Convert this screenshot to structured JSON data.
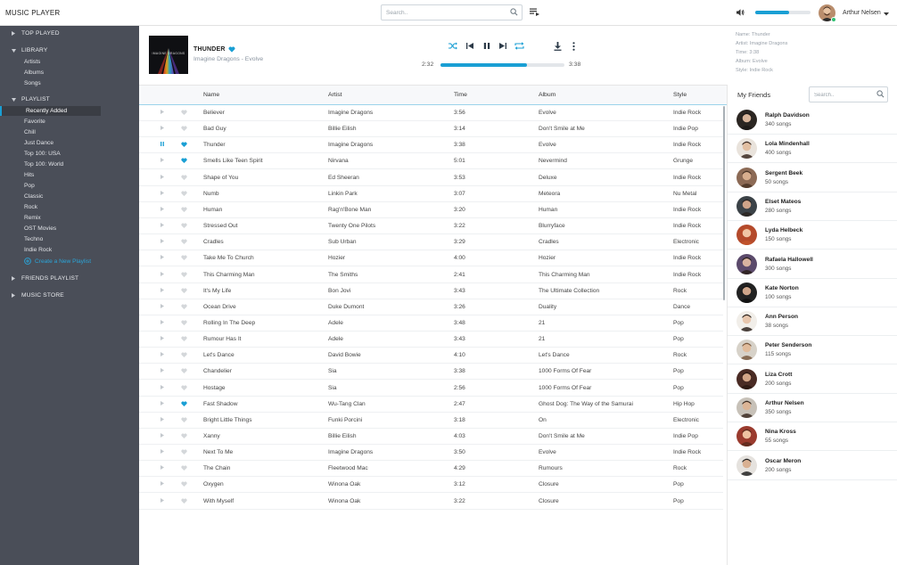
{
  "app": {
    "title": "MUSIC PLAYER"
  },
  "topbar": {
    "search_placeholder": "Search..",
    "volume_level": 0.62,
    "user_name": "Arthur Nelsen"
  },
  "sidebar": {
    "sections": [
      {
        "label": "TOP PLAYED",
        "expanded": false
      },
      {
        "label": "LIBRARY",
        "expanded": true
      },
      {
        "label": "PLAYLIST",
        "expanded": true
      },
      {
        "label": "FRIENDS PLAYLIST",
        "expanded": false
      },
      {
        "label": "MUSIC STORE",
        "expanded": false
      }
    ],
    "library_items": [
      "Artists",
      "Albums",
      "Songs"
    ],
    "playlist_items": [
      "Recently Added",
      "Favorite",
      "Chill",
      "Just Dance",
      "Top 100: USA",
      "Top 100: World",
      "Hits",
      "Pop",
      "Classic",
      "Rock",
      "Remix",
      "OST Movies",
      "Techno",
      "Indie Rock"
    ],
    "active_playlist": "Recently Added",
    "create_label": "Create a New Playlist"
  },
  "player": {
    "cover_text": "IMAGINE DRAGONS",
    "title": "THUNDER",
    "subtitle": "Imagine Dragons - Evolve",
    "elapsed": "2:32",
    "total": "3:38",
    "progress": 0.7
  },
  "track_info": {
    "name": "Name: Thunder",
    "artist": "Artist: Imagine Dragons",
    "time": "Time: 3:38",
    "album": "Album: Evolve",
    "style": "Style: Indie Rock"
  },
  "table": {
    "headers": {
      "name": "Name",
      "artist": "Artist",
      "time": "Time",
      "album": "Album",
      "style": "Style"
    },
    "rows": [
      {
        "name": "Believer",
        "artist": "Imagine Dragons",
        "time": "3:56",
        "album": "Evolve",
        "style": "Indie Rock",
        "liked": false,
        "playing": false
      },
      {
        "name": "Bad Guy",
        "artist": "Billie Eilish",
        "time": "3:14",
        "album": "Don't Smile at Me",
        "style": "Indie Pop",
        "liked": false,
        "playing": false
      },
      {
        "name": "Thunder",
        "artist": "Imagine Dragons",
        "time": "3:38",
        "album": "Evolve",
        "style": "Indie Rock",
        "liked": true,
        "playing": true
      },
      {
        "name": "Smells Like Teen Spirit",
        "artist": "Nirvana",
        "time": "5:01",
        "album": "Nevermind",
        "style": "Grunge",
        "liked": true,
        "playing": false
      },
      {
        "name": "Shape of You",
        "artist": "Ed Sheeran",
        "time": "3:53",
        "album": "Deluxe",
        "style": "Indie Rock",
        "liked": false,
        "playing": false
      },
      {
        "name": "Numb",
        "artist": "Linkin Park",
        "time": "3:07",
        "album": "Meteora",
        "style": "Nu Metal",
        "liked": false,
        "playing": false
      },
      {
        "name": "Human",
        "artist": "Rag'n'Bone Man",
        "time": "3:20",
        "album": "Human",
        "style": "Indie Rock",
        "liked": false,
        "playing": false
      },
      {
        "name": "Stressed Out",
        "artist": "Twenty One Pilots",
        "time": "3:22",
        "album": "Blurryface",
        "style": "Indie Rock",
        "liked": false,
        "playing": false
      },
      {
        "name": "Cradles",
        "artist": "Sub Urban",
        "time": "3:29",
        "album": "Cradles",
        "style": "Electronic",
        "liked": false,
        "playing": false
      },
      {
        "name": "Take Me To Church",
        "artist": "Hozier",
        "time": "4:00",
        "album": "Hozier",
        "style": "Indie Rock",
        "liked": false,
        "playing": false
      },
      {
        "name": "This Charming Man",
        "artist": "The Smiths",
        "time": "2:41",
        "album": "This Charming Man",
        "style": "Indie Rock",
        "liked": false,
        "playing": false
      },
      {
        "name": "It's My Life",
        "artist": "Bon Jovi",
        "time": "3:43",
        "album": "The Ultimate Collection",
        "style": "Rock",
        "liked": false,
        "playing": false
      },
      {
        "name": "Ocean Drive",
        "artist": "Duke Dumont",
        "time": "3:26",
        "album": "Duality",
        "style": "Dance",
        "liked": false,
        "playing": false
      },
      {
        "name": "Rolling In The Deep",
        "artist": "Adele",
        "time": "3:48",
        "album": "21",
        "style": "Pop",
        "liked": false,
        "playing": false
      },
      {
        "name": "Rumour Has It",
        "artist": "Adele",
        "time": "3:43",
        "album": "21",
        "style": "Pop",
        "liked": false,
        "playing": false
      },
      {
        "name": "Let's Dance",
        "artist": "David Bowie",
        "time": "4:10",
        "album": "Let's Dance",
        "style": "Rock",
        "liked": false,
        "playing": false
      },
      {
        "name": "Chandelier",
        "artist": "Sia",
        "time": "3:38",
        "album": "1000 Forms Of Fear",
        "style": "Pop",
        "liked": false,
        "playing": false
      },
      {
        "name": "Hostage",
        "artist": "Sia",
        "time": "2:56",
        "album": "1000 Forms Of Fear",
        "style": "Pop",
        "liked": false,
        "playing": false
      },
      {
        "name": "Fast Shadow",
        "artist": "Wu-Tang Clan",
        "time": "2:47",
        "album": "Ghost Dog: The Way of the Samurai",
        "style": "Hip Hop",
        "liked": true,
        "playing": false
      },
      {
        "name": "Bright Little Things",
        "artist": "Funki Porcini",
        "time": "3:18",
        "album": "On",
        "style": "Electronic",
        "liked": false,
        "playing": false
      },
      {
        "name": "Xanny",
        "artist": "Billie Eilish",
        "time": "4:03",
        "album": "Don't Smile at Me",
        "style": "Indie Pop",
        "liked": false,
        "playing": false
      },
      {
        "name": "Next To Me",
        "artist": "Imagine Dragons",
        "time": "3:50",
        "album": "Evolve",
        "style": "Indie Rock",
        "liked": false,
        "playing": false
      },
      {
        "name": "The Chain",
        "artist": "Fleetwood Mac",
        "time": "4:29",
        "album": "Rumours",
        "style": "Rock",
        "liked": false,
        "playing": false
      },
      {
        "name": "Oxygen",
        "artist": "Winona Oak",
        "time": "3:12",
        "album": "Closure",
        "style": "Pop",
        "liked": false,
        "playing": false
      },
      {
        "name": "With Myself",
        "artist": "Winona Oak",
        "time": "3:22",
        "album": "Closure",
        "style": "Pop",
        "liked": false,
        "playing": false
      }
    ]
  },
  "friends": {
    "title": "My Friends",
    "search_placeholder": "Search..",
    "list": [
      {
        "name": "Ralph Davidson",
        "songs": "340 songs"
      },
      {
        "name": "Lola Mindenhall",
        "songs": "400 songs"
      },
      {
        "name": "Sergent Beek",
        "songs": "50 songs"
      },
      {
        "name": "Elset Mateos",
        "songs": "280 songs"
      },
      {
        "name": "Lyda Helbeck",
        "songs": "150 songs"
      },
      {
        "name": "Rafaela Hallowell",
        "songs": "300 songs"
      },
      {
        "name": "Kate Norton",
        "songs": "100 songs"
      },
      {
        "name": "Ann Person",
        "songs": "38 songs"
      },
      {
        "name": "Peter Senderson",
        "songs": "115 songs"
      },
      {
        "name": "Liza Crott",
        "songs": "200 songs"
      },
      {
        "name": "Arthur Nelsen",
        "songs": "350 songs"
      },
      {
        "name": "Nina Kross",
        "songs": "55 songs"
      },
      {
        "name": "Oscar Meron",
        "songs": "200 songs"
      }
    ]
  },
  "colors": {
    "accent": "#1a9fd4",
    "sidebar_bg": "#4a4e58",
    "heart_on": "#1a9fd4",
    "heart_off": "#d4d7da"
  },
  "icons": [
    "search-icon",
    "queue-list-icon",
    "volume-icon",
    "caret-down-icon",
    "shuffle-icon",
    "previous-icon",
    "pause-icon",
    "next-icon",
    "repeat-icon",
    "download-icon",
    "more-vertical-icon",
    "heart-icon",
    "play-icon",
    "plus-circle-icon"
  ]
}
